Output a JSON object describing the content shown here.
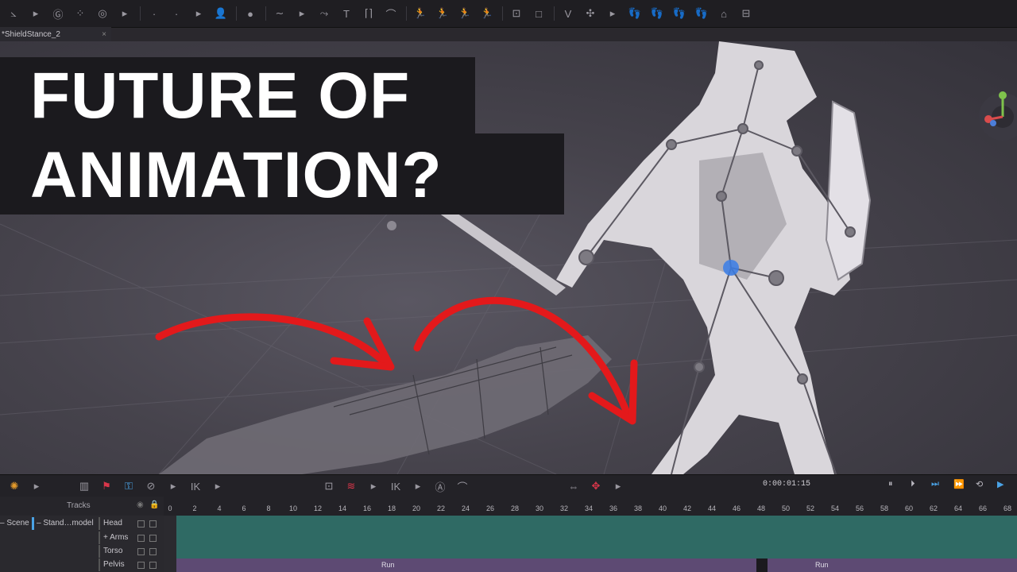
{
  "tab": {
    "title": "*ShieldStance_2",
    "close": "×"
  },
  "headline": {
    "line1": "FUTURE OF",
    "line2": "ANIMATION?"
  },
  "viewport": {
    "character": "animated soldier with sword and shield",
    "arrow_color": "#e3191b"
  },
  "timeline": {
    "timecode": "0:00:01:15",
    "tracks_label": "Tracks",
    "ruler_ticks": [
      "0",
      "2",
      "4",
      "6",
      "8",
      "10",
      "12",
      "14",
      "16",
      "18",
      "20",
      "22",
      "24",
      "26",
      "28",
      "30",
      "32",
      "34",
      "36",
      "38",
      "40",
      "42",
      "44",
      "46",
      "48",
      "50",
      "52",
      "54",
      "56",
      "58",
      "60",
      "62",
      "64",
      "66",
      "68"
    ],
    "tree": {
      "scene": "Scene",
      "model": "Stand…model",
      "tracks": [
        "Head",
        "Arms",
        "Torso",
        "Pelvis"
      ]
    },
    "clips": [
      "Run",
      "Run"
    ]
  },
  "colors": {
    "green_lane": "#2f6a64",
    "purple_lane": "#5d4a73",
    "headline_bg": "#1b1a1e"
  }
}
